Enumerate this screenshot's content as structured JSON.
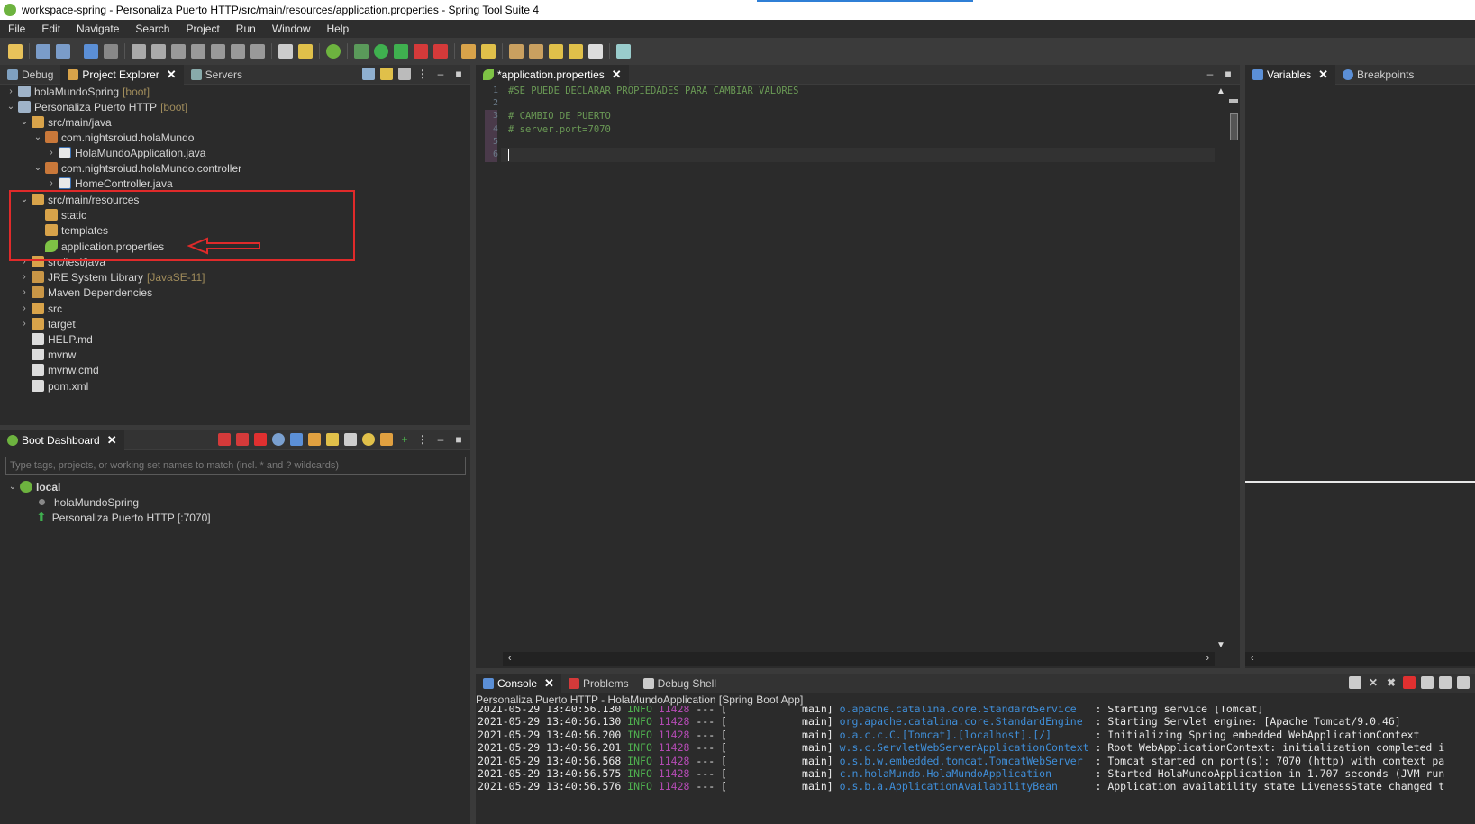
{
  "window": {
    "title": "workspace-spring - Personaliza Puerto HTTP/src/main/resources/application.properties - Spring Tool Suite 4"
  },
  "menu": [
    "File",
    "Edit",
    "Navigate",
    "Search",
    "Project",
    "Run",
    "Window",
    "Help"
  ],
  "left_top": {
    "tabs": [
      {
        "label": "Debug",
        "active": false
      },
      {
        "label": "Project Explorer",
        "active": true,
        "close": "✕"
      },
      {
        "label": "Servers",
        "active": false
      }
    ],
    "tree": [
      {
        "label": "holaMundoSpring",
        "decor": "[boot]"
      },
      {
        "label": "Personaliza Puerto HTTP",
        "decor": "[boot]"
      },
      {
        "label": "src/main/java",
        "decor": ""
      },
      {
        "label": "com.nightsroiud.holaMundo",
        "decor": ""
      },
      {
        "label": "HolaMundoApplication.java",
        "decor": ""
      },
      {
        "label": "com.nightsroiud.holaMundo.controller",
        "decor": ""
      },
      {
        "label": "HomeController.java",
        "decor": ""
      },
      {
        "label": "src/main/resources",
        "decor": ""
      },
      {
        "label": "static",
        "decor": ""
      },
      {
        "label": "templates",
        "decor": ""
      },
      {
        "label": "application.properties",
        "decor": ""
      },
      {
        "label": "src/test/java",
        "decor": ""
      },
      {
        "label": "JRE System Library",
        "decor": "[JavaSE-11]"
      },
      {
        "label": "Maven Dependencies",
        "decor": ""
      },
      {
        "label": "src",
        "decor": ""
      },
      {
        "label": "target",
        "decor": ""
      },
      {
        "label": "HELP.md",
        "decor": ""
      },
      {
        "label": "mvnw",
        "decor": ""
      },
      {
        "label": "mvnw.cmd",
        "decor": ""
      },
      {
        "label": "pom.xml",
        "decor": ""
      }
    ]
  },
  "left_bottom": {
    "tab": {
      "label": "Boot Dashboard",
      "close": "✕"
    },
    "filter_placeholder": "Type tags, projects, or working set names to match (incl. * and ? wildcards)",
    "tree": [
      {
        "label": "local"
      },
      {
        "label": "holaMundoSpring"
      },
      {
        "label": "Personaliza Puerto HTTP [:7070]"
      }
    ]
  },
  "editor": {
    "tab": {
      "label": "*application.properties",
      "close": "✕"
    },
    "line_numbers": [
      "1",
      "2",
      "3",
      "4",
      "5",
      "6"
    ],
    "lines": [
      "#SE PUEDE DECLARAR PROPIEDADES PARA CAMBIAR VALORES",
      "",
      "# CAMBIO DE PUERTO",
      "# server.port=7070",
      "",
      ""
    ]
  },
  "right": {
    "tabs": [
      {
        "label": "Variables",
        "active": true,
        "close": "✕"
      },
      {
        "label": "Breakpoints",
        "active": false
      }
    ]
  },
  "console": {
    "tabs": [
      {
        "label": "Console",
        "active": true,
        "close": "✕"
      },
      {
        "label": "Problems",
        "active": false
      },
      {
        "label": "Debug Shell",
        "active": false
      }
    ],
    "process": "Personaliza Puerto HTTP - HolaMundoApplication [Spring Boot App]",
    "lines": [
      {
        "ts": "2021-05-29 13:40:56.130",
        "level": "INFO",
        "pid": "11428",
        "sep": "--- [",
        "thread": "           main]",
        "cls": "o.apache.catalina.core.StandardService  ",
        "msg": ": Starting service [Tomcat]"
      },
      {
        "ts": "2021-05-29 13:40:56.130",
        "level": "INFO",
        "pid": "11428",
        "sep": "--- [",
        "thread": "           main]",
        "cls": "org.apache.catalina.core.StandardEngine ",
        "msg": ": Starting Servlet engine: [Apache Tomcat/9.0.46]"
      },
      {
        "ts": "2021-05-29 13:40:56.200",
        "level": "INFO",
        "pid": "11428",
        "sep": "--- [",
        "thread": "           main]",
        "cls": "o.a.c.c.C.[Tomcat].[localhost].[/]      ",
        "msg": ": Initializing Spring embedded WebApplicationContext"
      },
      {
        "ts": "2021-05-29 13:40:56.201",
        "level": "INFO",
        "pid": "11428",
        "sep": "--- [",
        "thread": "           main]",
        "cls": "w.s.c.ServletWebServerApplicationContext",
        "msg": ": Root WebApplicationContext: initialization completed i"
      },
      {
        "ts": "2021-05-29 13:40:56.568",
        "level": "INFO",
        "pid": "11428",
        "sep": "--- [",
        "thread": "           main]",
        "cls": "o.s.b.w.embedded.tomcat.TomcatWebServer ",
        "msg": ": Tomcat started on port(s): 7070 (http) with context pa"
      },
      {
        "ts": "2021-05-29 13:40:56.575",
        "level": "INFO",
        "pid": "11428",
        "sep": "--- [",
        "thread": "           main]",
        "cls": "c.n.holaMundo.HolaMundoApplication      ",
        "msg": ": Started HolaMundoApplication in 1.707 seconds (JVM run"
      },
      {
        "ts": "2021-05-29 13:40:56.576",
        "level": "INFO",
        "pid": "11428",
        "sep": "--- [",
        "thread": "           main]",
        "cls": "o.s.b.a.ApplicationAvailabilityBean     ",
        "msg": ": Application availability state LivenessState changed t"
      }
    ]
  },
  "colors": {
    "accent": "#6db33f",
    "highlight": "#e02a2a",
    "console_class": "#3f8ed8"
  }
}
